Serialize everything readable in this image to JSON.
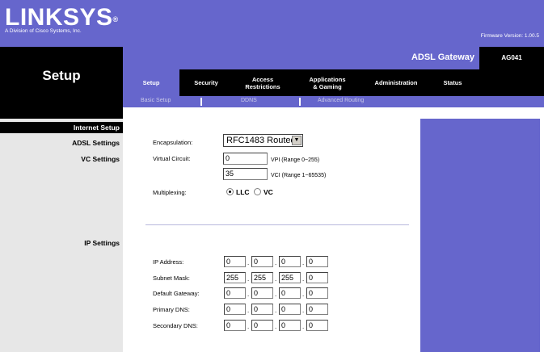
{
  "brand": {
    "logo": "LINKSYS",
    "logo_mark": "®",
    "subtitle": "A Division of Cisco Systems, Inc.",
    "firmware": "Firmware Version: 1.00.5"
  },
  "page_title": "Setup",
  "product": {
    "name": "ADSL Gateway",
    "model": "AG041"
  },
  "tabs": [
    {
      "label": "Setup"
    },
    {
      "label": "Security"
    },
    {
      "label": "Access\nRestrictions"
    },
    {
      "label": "Applications\n& Gaming"
    },
    {
      "label": "Administration"
    },
    {
      "label": "Status"
    }
  ],
  "subtabs": [
    {
      "label": "Basic Setup"
    },
    {
      "label": "DDNS"
    },
    {
      "label": "Advanced Routing"
    }
  ],
  "sections": {
    "internet_setup": "Internet Setup",
    "adsl_settings": "ADSL Settings",
    "vc_settings": "VC Settings",
    "ip_settings": "IP Settings"
  },
  "form": {
    "encapsulation_label": "Encapsulation:",
    "encapsulation_value": "RFC1483 Routed",
    "virtual_circuit_label": "Virtual Circuit:",
    "vpi_value": "0",
    "vpi_hint": "VPI (Range 0~255)",
    "vci_value": "35",
    "vci_hint": "VCI (Range 1~65535)",
    "multiplexing_label": "Multiplexing:",
    "mux_llc": "LLC",
    "mux_vc": "VC",
    "mux_selected": "LLC",
    "ip_address_label": "IP Address:",
    "ip_address": [
      "0",
      "0",
      "0",
      "0"
    ],
    "subnet_mask_label": "Subnet Mask:",
    "subnet_mask": [
      "255",
      "255",
      "255",
      "0"
    ],
    "default_gateway_label": "Default Gateway:",
    "default_gateway": [
      "0",
      "0",
      "0",
      "0"
    ],
    "primary_dns_label": "Primary DNS:",
    "primary_dns": [
      "0",
      "0",
      "0",
      "0"
    ],
    "secondary_dns_label": "Secondary DNS:",
    "secondary_dns": [
      "0",
      "0",
      "0",
      "0"
    ]
  },
  "colors": {
    "brand_purple": "#6666cc",
    "black": "#000000",
    "side_gray": "#e7e7e7"
  }
}
